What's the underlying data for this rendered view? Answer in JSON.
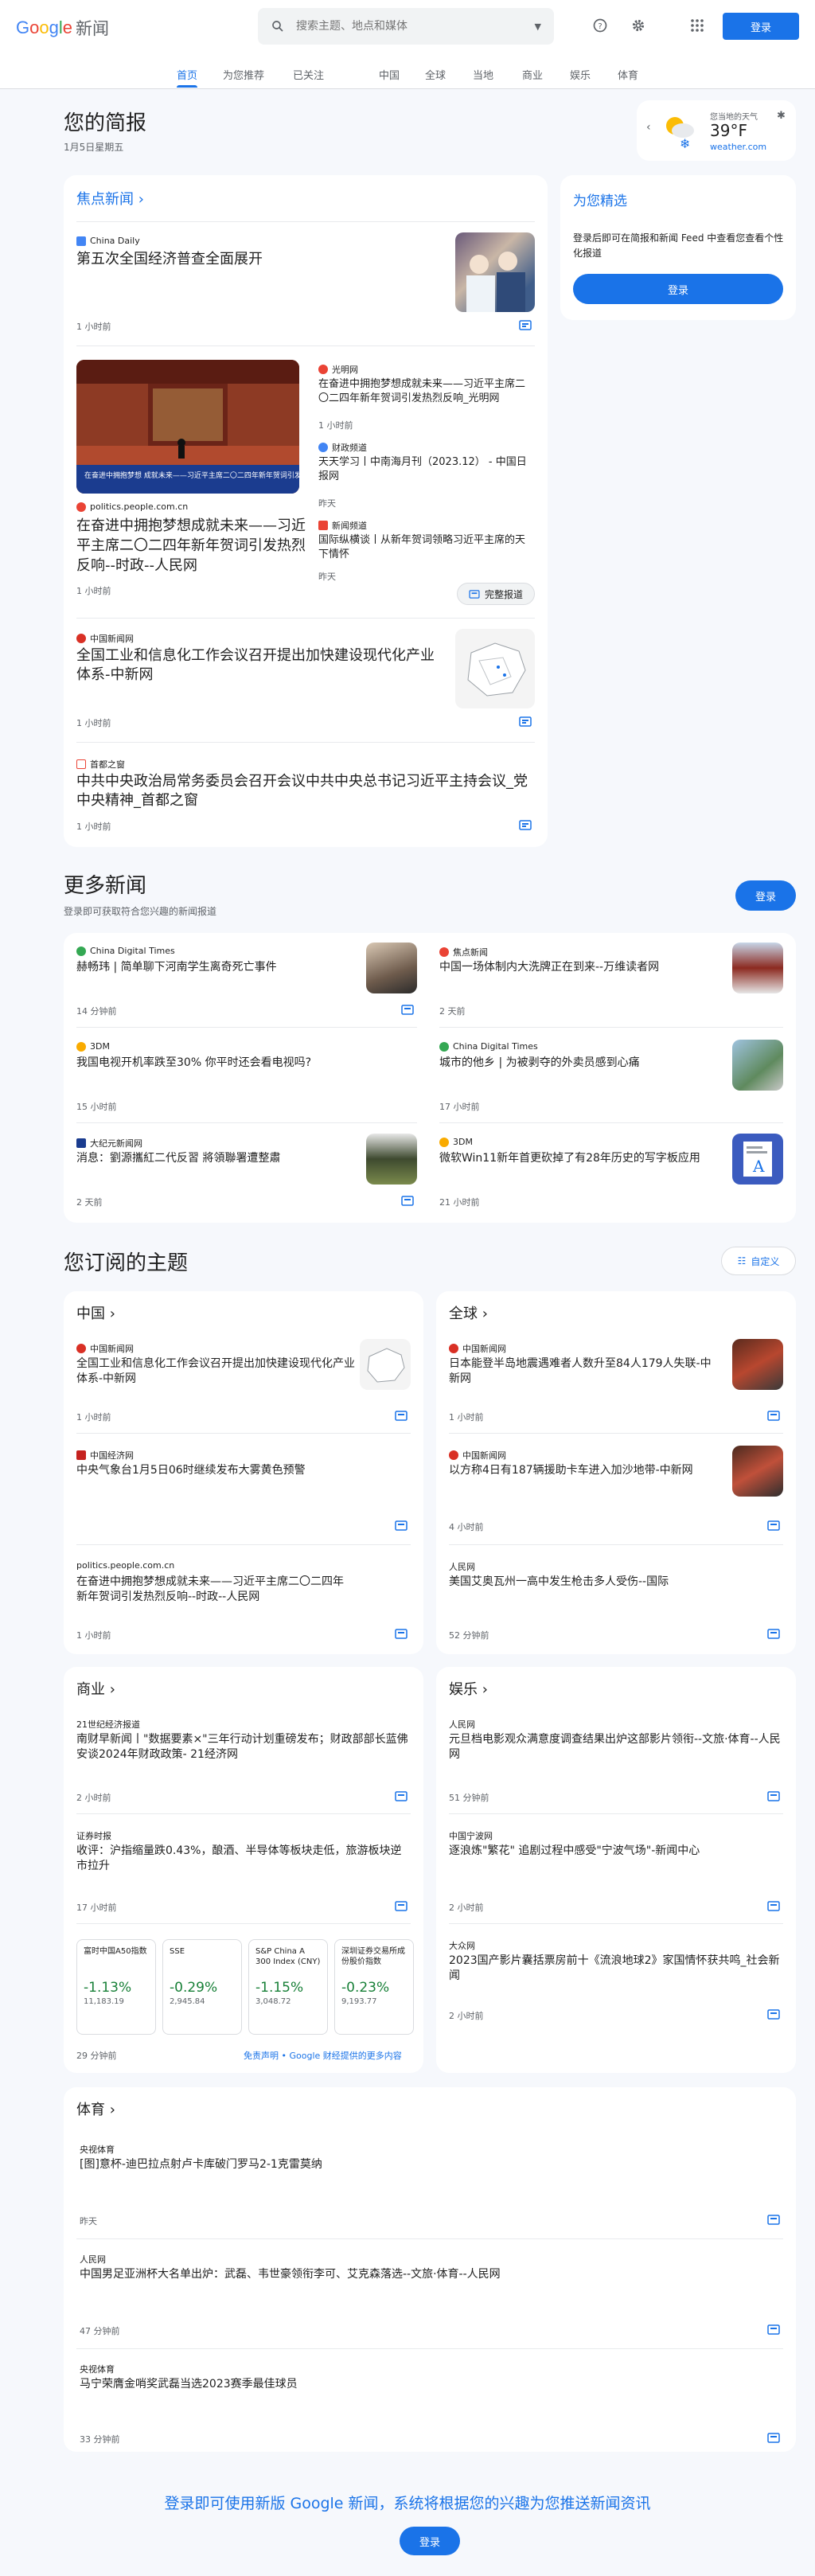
{
  "header": {
    "logo_letters": [
      "G",
      "o",
      "o",
      "g",
      "l",
      "e"
    ],
    "logo_suffix": "新闻",
    "search_placeholder": "搜索主题、地点和媒体",
    "login": "登录"
  },
  "nav": [
    "首页",
    "为您推荐",
    "已关注",
    "中国",
    "全球",
    "当地",
    "商业",
    "娱乐",
    "体育"
  ],
  "briefing": {
    "title": "您的简报",
    "date": "1月5日星期五"
  },
  "weather": {
    "label": "您当地的天气",
    "temp": "39°F",
    "source": "weather.com"
  },
  "foryou": {
    "title": "为您精选",
    "text": "登录后即可在简报和新闻 Feed 中查看您查看个性化报道",
    "button": "登录"
  },
  "top": {
    "title": "焦点新闻",
    "s1": {
      "source": "China Daily",
      "title": "第五次全国经济普查全面展开",
      "time": "1 小时前"
    },
    "s2": {
      "source": "politics.people.com.cn",
      "title": "在奋进中拥抱梦想成就未来——习近平主席二〇二四年新年贺词引发热烈反响--时政--人民网",
      "time": "1 小时前",
      "caption": "在奋进中拥抱梦想 成就未来——习近平主席二〇二四年新年贺词引发热烈反响",
      "side": [
        {
          "source": "光明网",
          "title": "在奋进中拥抱梦想成就未来——习近平主席二〇二四年新年贺词引发热烈反响_光明网",
          "time": "1 小时前"
        },
        {
          "source": "财政频道",
          "title": "天天学习丨中南海月刊（2023.12） - 中国日报网",
          "time": "昨天"
        },
        {
          "source": "新闻频道",
          "title": "国际纵横谈丨从新年贺词领略习近平主席的天下情怀",
          "time": "昨天"
        }
      ],
      "full": "完整报道"
    },
    "s3": {
      "source": "中国新闻网",
      "title": "全国工业和信息化工作会议召开提出加快建设现代化产业体系-中新网",
      "time": "1 小时前"
    },
    "s4": {
      "source": "首都之窗",
      "title": "中共中央政治局常务委员会召开会议中共中央总书记习近平主持会议_党中央精神_首都之窗",
      "time": "1 小时前"
    }
  },
  "more": {
    "title": "更多新闻",
    "subtitle": "登录即可获取符合您兴趣的新闻报道",
    "button": "登录",
    "items": [
      {
        "source": "China Digital Times",
        "title": "赫畅玮 | 简单聊下河南学生离奇死亡事件",
        "time": "14 分钟前"
      },
      {
        "source": "焦点新闻",
        "title": "中国一场体制内大洗牌正在到来--万维读者网",
        "time": "2 天前"
      },
      {
        "source": "3DM",
        "title": "我国电视开机率跌至30% 你平时还会看电视吗?",
        "time": "15 小时前"
      },
      {
        "source": "China Digital Times",
        "title": "城市的他乡 | 为被剥夺的外卖员感到心痛",
        "time": "17 小时前"
      },
      {
        "source": "大纪元新闻网",
        "title": "消息：劉源攜紅二代反習 將領聯署遭整肅",
        "time": "2 天前"
      },
      {
        "source": "3DM",
        "title": "微软Win11新年首更砍掉了有28年历史的写字板应用",
        "time": "21 小时前"
      }
    ]
  },
  "topics": {
    "title": "您订阅的主题",
    "customize": "自定义",
    "china": {
      "title": "中国",
      "items": [
        {
          "source": "中国新闻网",
          "title": "全国工业和信息化工作会议召开提出加快建设现代化产业体系-中新网",
          "time": "1 小时前"
        },
        {
          "source": "中国经济网",
          "title": "中央气象台1月5日06时继续发布大雾黄色预警",
          "time": ""
        },
        {
          "source": "politics.people.com.cn",
          "title": "在奋进中拥抱梦想成就未来——习近平主席二〇二四年新年贺词引发热烈反响--时政--人民网",
          "time": "1 小时前"
        }
      ]
    },
    "world": {
      "title": "全球",
      "items": [
        {
          "source": "中国新闻网",
          "title": "日本能登半岛地震遇难者人数升至84人179人失联-中新网",
          "time": "1 小时前"
        },
        {
          "source": "中国新闻网",
          "title": "以方称4日有187辆援助卡车进入加沙地带-中新网",
          "time": "4 小时前"
        },
        {
          "source": "人民网",
          "title": "美国艾奥瓦州一高中发生枪击多人受伤--国际",
          "time": "52 分钟前"
        }
      ]
    },
    "business": {
      "title": "商业",
      "items": [
        {
          "source": "21世纪经济报道",
          "title": "南财早新闻丨\"数据要素×\"三年行动计划重磅发布；财政部部长蓝佛安谈2024年财政政策- 21经济网",
          "time": "2 小时前"
        },
        {
          "source": "证券时报",
          "title": "收评：沪指缩量跌0.43%，酿酒、半导体等板块走低，旅游板块逆市拉升",
          "time": "17 小时前"
        }
      ],
      "stocks": [
        {
          "name": "富时中国A50指数",
          "pct": "-1.13%",
          "val": "11,183.19"
        },
        {
          "name": "SSE",
          "pct": "-0.29%",
          "val": "2,945.84"
        },
        {
          "name": "S&P China A 300 Index (CNY)",
          "pct": "-1.15%",
          "val": "3,048.72"
        },
        {
          "name": "深圳证券交易所成份股价指数",
          "pct": "-0.23%",
          "val": "9,193.77"
        }
      ],
      "stock_time": "29 分钟前",
      "disclaimer": "免责声明 • Google 财经提供的更多内容"
    },
    "ent": {
      "title": "娱乐",
      "items": [
        {
          "source": "人民网",
          "title": "元旦档电影观众满意度调查结果出炉这部影片领衔--文旅·体育--人民网",
          "time": "51 分钟前"
        },
        {
          "source": "中国宁波网",
          "title": "逐浪炼\"繁花\" 追剧过程中感受\"宁波气场\"-新闻中心",
          "time": "2 小时前"
        },
        {
          "source": "大众网",
          "title": "2023国产影片囊括票房前十《流浪地球2》家国情怀获共鸣_社会新闻",
          "time": "2 小时前"
        }
      ]
    },
    "sports": {
      "title": "体育",
      "items": [
        {
          "source": "央视体育",
          "title": "[图]意杯-迪巴拉点射卢卡库破门罗马2-1克雷莫纳",
          "time": "昨天"
        },
        {
          "source": "人民网",
          "title": "中国男足亚洲杯大名单出炉：武磊、韦世豪领衔李可、艾克森落选--文旅·体育--人民网",
          "time": "47 分钟前"
        },
        {
          "source": "央视体育",
          "title": "马宁荣膺金哨奖武磊当选2023赛季最佳球员",
          "time": "33 分钟前"
        }
      ]
    }
  },
  "footer": {
    "text": "登录即可使用新版 Google 新闻，系统将根据您的兴趣为您推送新闻资讯",
    "button": "登录"
  },
  "colors": {
    "accent": "#1a73e8",
    "stock_up": "#188038",
    "logo_blue": "#4285f4",
    "logo_red": "#ea4335",
    "logo_yellow": "#fbbc05",
    "logo_green": "#34a853"
  }
}
